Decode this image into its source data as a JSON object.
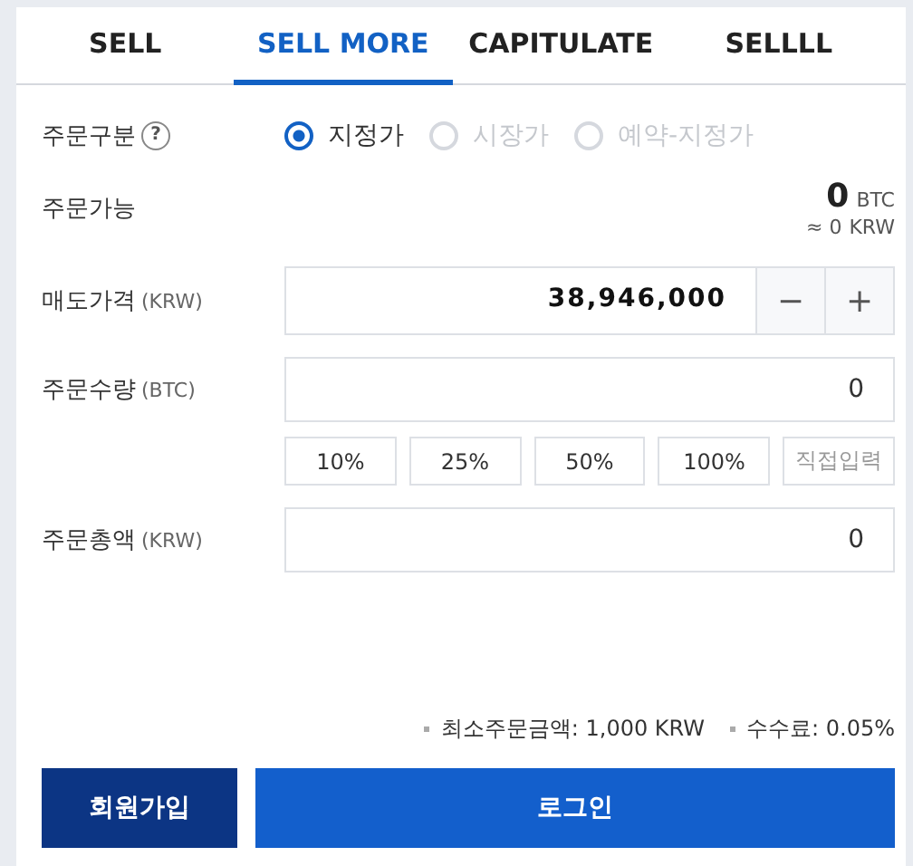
{
  "tabs": [
    {
      "label": "SELL",
      "selected": false
    },
    {
      "label": "SELL MORE",
      "selected": true
    },
    {
      "label": "CAPITULATE",
      "selected": false
    },
    {
      "label": "SELLLL",
      "selected": false
    }
  ],
  "order_type": {
    "label": "주문구분",
    "help": "?",
    "options": [
      {
        "label": "지정가",
        "selected": true,
        "disabled": false
      },
      {
        "label": "시장가",
        "selected": false,
        "disabled": true
      },
      {
        "label": "예약-지정가",
        "selected": false,
        "disabled": true
      }
    ]
  },
  "available": {
    "label": "주문가능",
    "amount": "0",
    "unit": "BTC",
    "approx": "≈ 0",
    "approx_unit": "KRW"
  },
  "price": {
    "label": "매도가격",
    "unit": "(KRW)",
    "value": "38,946,000",
    "minus": "−",
    "plus": "+"
  },
  "quantity": {
    "label": "주문수량",
    "unit": "(BTC)",
    "value": "0",
    "percent_buttons": [
      "10%",
      "25%",
      "50%",
      "100%"
    ],
    "direct_input": "직접입력"
  },
  "total": {
    "label": "주문총액",
    "unit": "(KRW)",
    "value": "0"
  },
  "notes": [
    "최소주문금액: 1,000 KRW",
    "수수료: 0.05%"
  ],
  "buttons": {
    "signup": "회원가입",
    "login": "로그인"
  }
}
